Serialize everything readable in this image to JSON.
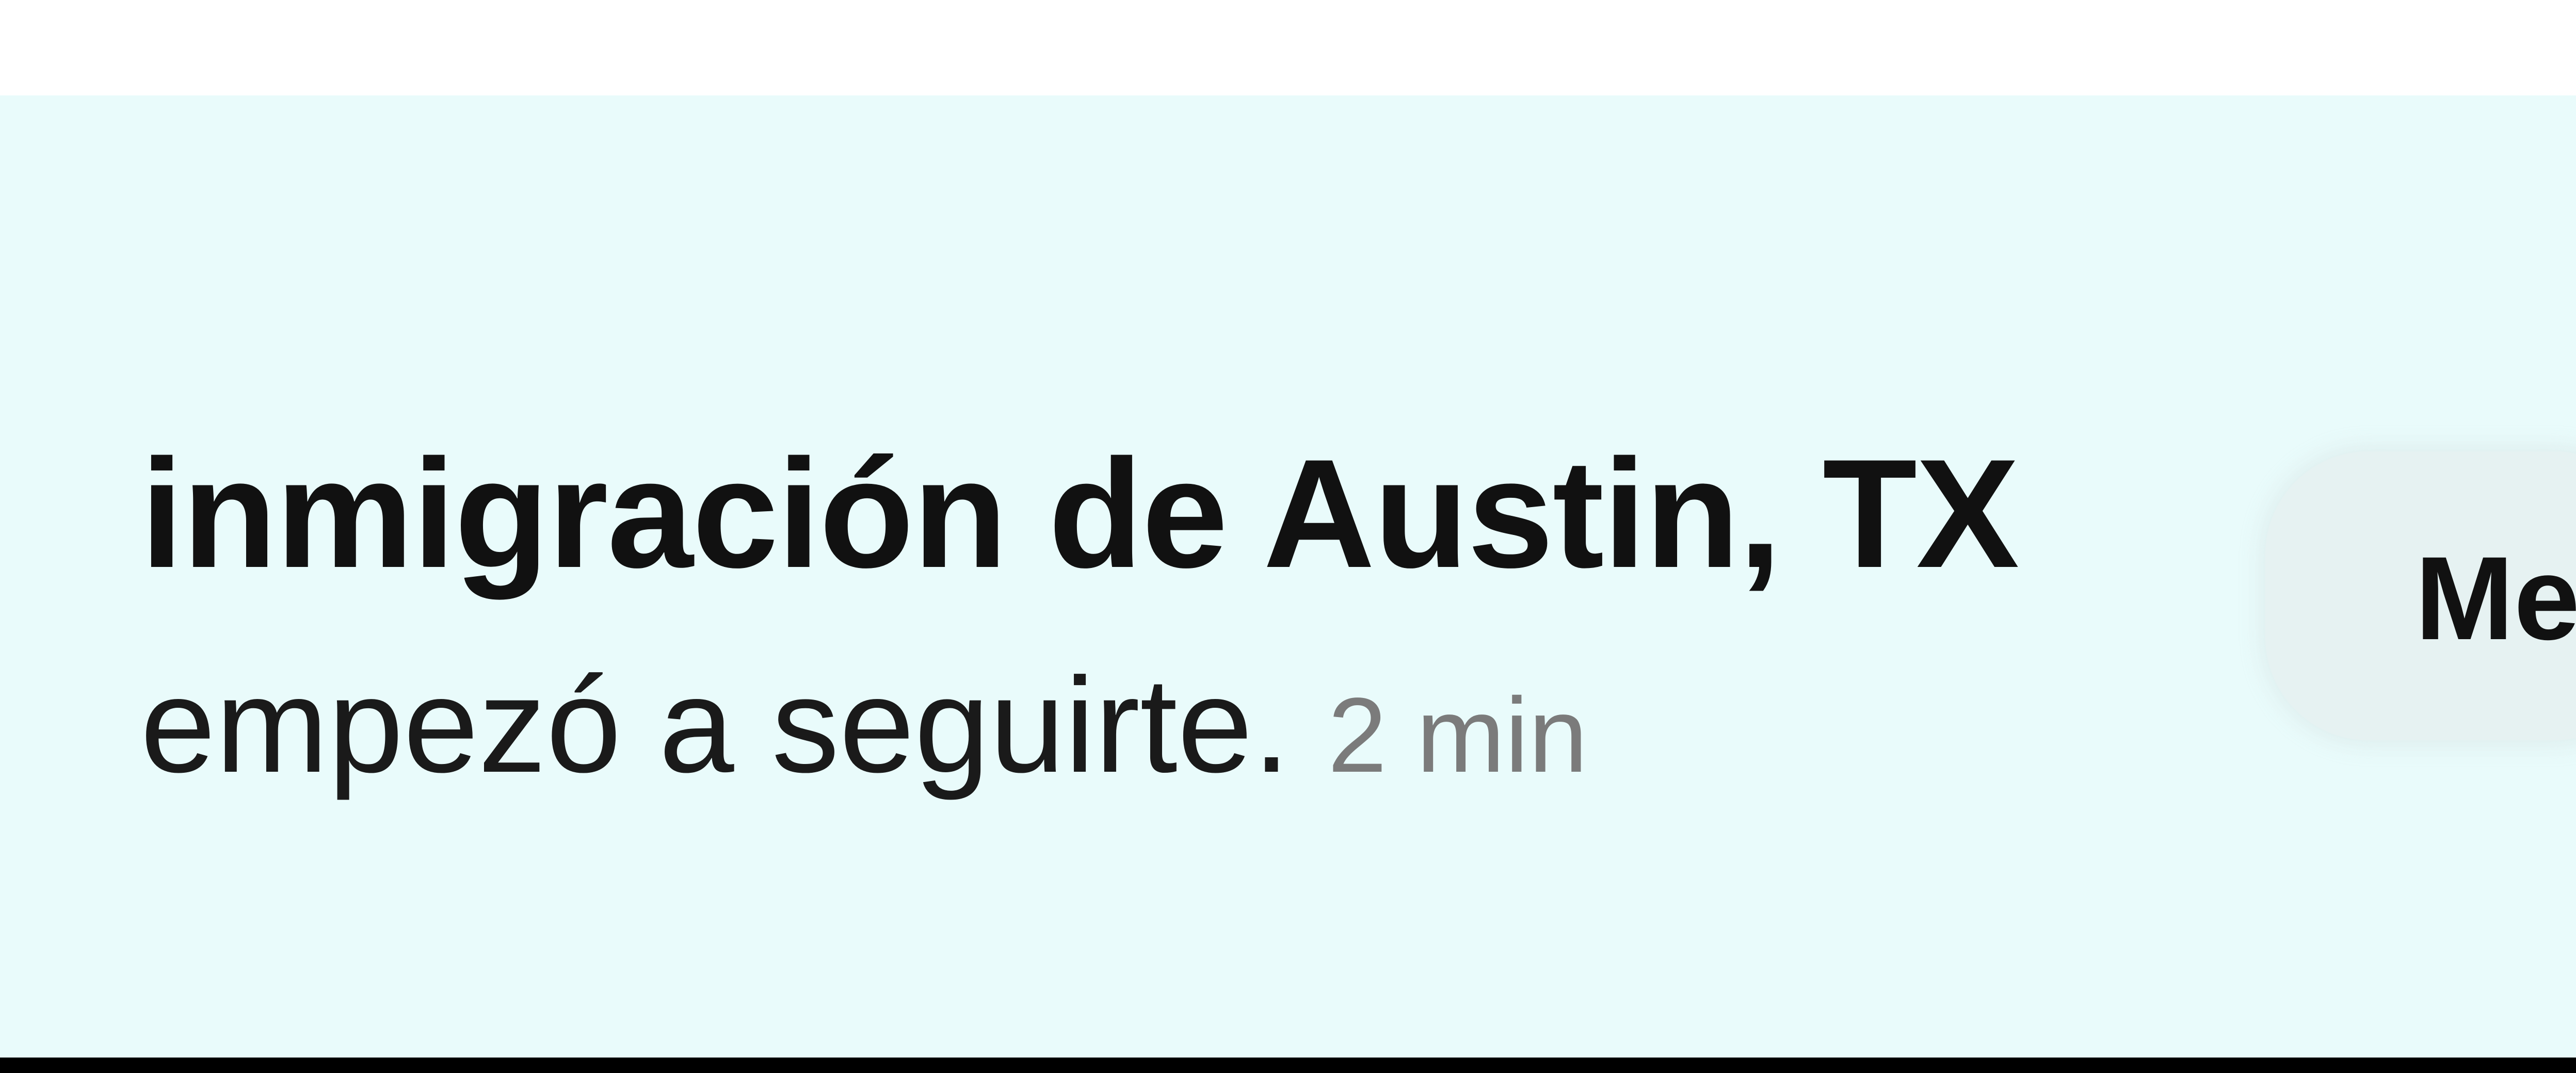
{
  "notification": {
    "username": "inmigración de Austin, TX",
    "message": "empezó a seguirte.",
    "timestamp": "2 min",
    "action_button_label": "Me"
  },
  "colors": {
    "row_background": "#e9fbfb",
    "avatar_ring": "#3ad9c6",
    "timestamp": "#7b7b7b",
    "button_background": "#e6f2f2"
  },
  "icons": {
    "avatar": "avatar-ring-icon"
  }
}
